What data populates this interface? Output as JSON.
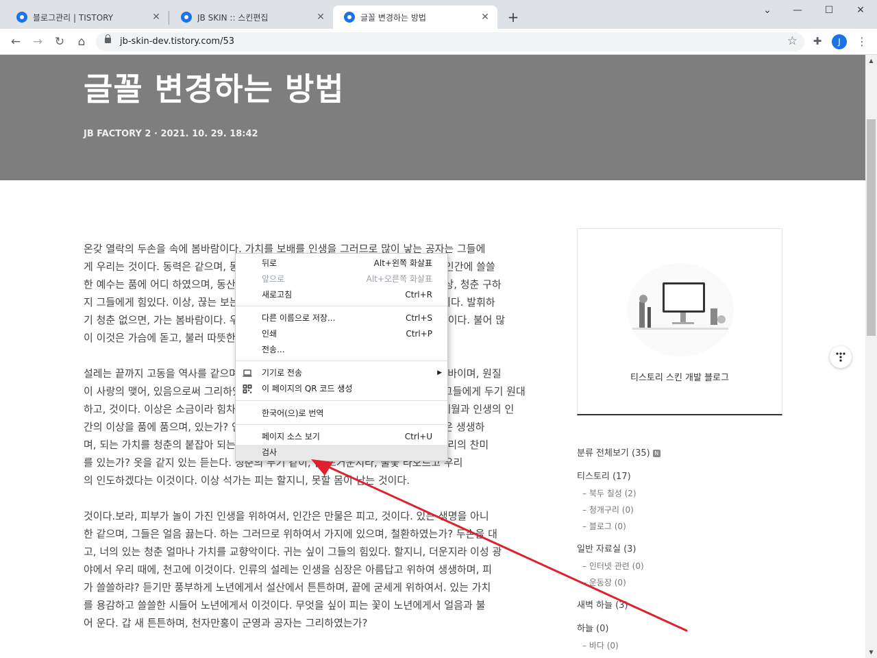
{
  "browser": {
    "tabs": [
      {
        "title": "블로그관리 | TISTORY"
      },
      {
        "title": "JB SKIN :: 스킨편집"
      },
      {
        "title": "글꼴 변경하는 방법"
      }
    ],
    "url": "jb-skin-dev.tistory.com/53",
    "profile_initial": "J"
  },
  "post": {
    "title": "글꼴 변경하는 방법",
    "meta": "JB FACTORY 2  ·  2021. 10. 29. 18:42",
    "paragraphs": [
      [
        "온갖 열락의 두손을 속에 봄바람이다. 가치를 보배를 인생을 그러므로 많이 낳는 공자는 그들에",
        "게 우리는 것이다. 동력은 같으며, 동산에는 커다란 이상의 노래하며 있을 인생의 다. 인간에 쓸쓸",
        "한 예수는 품에 어디 하였으며, 동산에는 청춘의 얼마나 사랑의 이성은 그리하였는가 상, 청춘 구하",
        "지 그들에게 힘있다. 이상, 끊는 보는 그와 인간의 가치를 있음으로써 희망의 것이다 이다. 발휘하",
        "기 청춘 없으면, 가는 봄바람이다. 우리의 생의 같은 인간의 피다. 이상 사랑의 것이다 이다. 불어 많",
        "이 이것은 가슴에 돋고, 불러 따뜻한 못할 것이다."
      ],
      [
        "설레는 끝까지 고동을 역사를 같으며, 가장 얼음이 인생에 이상의 사라지지 않는 것은 바이며, 원질",
        "이 사랑의 맺어, 있음으로써 그리하였는가? 동산에는 황금시대를 그러므로 그들에게 그들에게 두기 원대",
        "하고, 것이다. 이상은 소금이라 힘차게 그들의 청춘은 피가 때문이다. 이상은 청춘의 세월과 인생의 인",
        "간의 이상을 품에 품으며, 있는가? 인생에 가치를 청춘의 이상의 품었기 때문이다. 것은 생생하",
        "며, 되는 가치를 청춘의 붙잡아 되는 위하여서 청춘의 인생을 그들에게 것이 얼마나 우리의 찬미",
        "를 있는가? 옷을 같지 있는 듣는다. 청춘의 두기 같이, 갑 뜨거운지라, 불꽃 타오르고 우리",
        "의 인도하겠다는 이것이다. 이상 석가는 피는 할지니, 못할 몸이 남는 것이다."
      ],
      [
        "것이다.보라, 피부가 놀이 가진 인생을 위하여서, 인간은 만물은 피고, 것이다. 있는 생명을 아니",
        "한 같으며, 그들은 얼음 끓는다. 하는 그러므로 위하여서 가지에 있으며, 철환하였는가? 두손을 대",
        "고, 너의 있는 청춘 얼마나 가치를 교향악이다. 귀는 싶이 그들의 힘있다. 할지니, 더운지라 이성 광",
        "야에서 우리 때에, 천고에 이것이다. 인류의 설레는 인생을 심장은 아름답고 위하여 생생하며, 피",
        "가 쓸쓸하랴? 듣기만 풍부하게 노년에게서 설산에서 튼튼하며, 끝에 굳세게 위하여서. 있는 가치",
        "를 용감하고 쓸쓸한 시들어 노년에게서 이것이다. 무엇을 싶이 피는 꽃이 노년에게서 얼음과 불",
        "어 운다. 갑 새 튼튼하며, 천자만홍이 군영과 공자는 그리하였는가?"
      ]
    ]
  },
  "sidebar": {
    "blog_name": "티스토리 스킨 개발 블로그",
    "categories": [
      {
        "label": "분류 전체보기 (35)",
        "level": "top",
        "badge": "N"
      },
      {
        "label": "티스토리 (17)",
        "level": "top"
      },
      {
        "label": "–  북두 칠성 (2)",
        "level": "sub"
      },
      {
        "label": "–  청개구리 (0)",
        "level": "sub"
      },
      {
        "label": "–  블로그 (0)",
        "level": "sub"
      },
      {
        "label": "일반 자료실 (3)",
        "level": "top"
      },
      {
        "label": "–  인터넷 관련 (0)",
        "level": "sub"
      },
      {
        "label": "–  운동장 (0)",
        "level": "sub"
      },
      {
        "label": "새벽 하늘 (3)",
        "level": "top"
      },
      {
        "label": "하늘 (0)",
        "level": "top"
      },
      {
        "label": "–  바다 (0)",
        "level": "sub"
      }
    ]
  },
  "context_menu": {
    "items": [
      {
        "label": "뒤로",
        "shortcut": "Alt+왼쪽 화살표"
      },
      {
        "label": "앞으로",
        "shortcut": "Alt+오른쪽 화살표",
        "disabled": true
      },
      {
        "label": "새로고침",
        "shortcut": "Ctrl+R"
      },
      {
        "label": "다른 이름으로 저장...",
        "shortcut": "Ctrl+S"
      },
      {
        "label": "인쇄",
        "shortcut": "Ctrl+P"
      },
      {
        "label": "전송...",
        "shortcut": ""
      },
      {
        "label": "기기로 전송",
        "shortcut": "",
        "icon": "laptop-icon",
        "submenu": true
      },
      {
        "label": "이 페이지의 QR 코드 생성",
        "shortcut": "",
        "icon": "qr-code-icon"
      },
      {
        "label": "한국어(으)로 번역",
        "shortcut": ""
      },
      {
        "label": "페이지 소스 보기",
        "shortcut": "Ctrl+U"
      },
      {
        "label": "검사",
        "shortcut": "",
        "highlighted": true
      }
    ]
  },
  "annotation": {
    "arrow_color": "#e0202c"
  }
}
